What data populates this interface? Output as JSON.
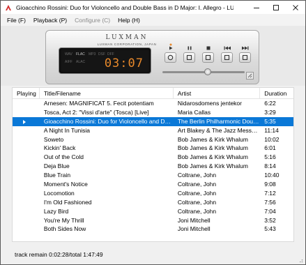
{
  "window": {
    "title": "Gioacchino Rossini: Duo for Violoncello and Double Bass in D Major: I. Allegro - LUXMAN..."
  },
  "menu": [
    {
      "label": "File (F)",
      "enabled": true
    },
    {
      "label": "Playback (P)",
      "enabled": true
    },
    {
      "label": "Configure (C)",
      "enabled": false
    },
    {
      "label": "Help (H)",
      "enabled": true
    }
  ],
  "player": {
    "brand": "LUXMAN",
    "brand_sub": "LUXMAN CORPORATION, JAPAN",
    "formats_top": [
      "WAV",
      "FLAC",
      "MP3",
      "DSF",
      "DFF"
    ],
    "formats_bottom": [
      "AIFF",
      "ALAC"
    ],
    "active_formats": [
      "FLAC"
    ],
    "time": "03:07",
    "accent_color": "#e8892b",
    "controls": [
      {
        "name": "play-button",
        "icon": "play-icon",
        "label_icon": "play-indicator-icon"
      },
      {
        "name": "pause-button",
        "icon": "pause-icon",
        "label_icon": "pause-indicator-icon"
      },
      {
        "name": "stop-button",
        "icon": "stop-icon",
        "label_icon": "stop-indicator-icon"
      },
      {
        "name": "previous-button",
        "icon": "previous-track-icon",
        "label_icon": "previous-indicator-icon"
      },
      {
        "name": "next-button",
        "icon": "next-track-icon",
        "label_icon": "next-indicator-icon"
      }
    ],
    "seek_fraction": 0.55
  },
  "playlist": {
    "columns": [
      "Playing",
      "Title/Filename",
      "Artist",
      "Duration"
    ],
    "selected_index": 2,
    "selection_color": "#0a78d7",
    "rows": [
      {
        "title": "Arnesen: MAGNIFICAT 5. Fecit potentiam",
        "artist": "Nidarosdomens jentekor",
        "duration": "6:22"
      },
      {
        "title": "Tosca, Act 2: \"Vissi d'arte\" (Tosca) [Live]",
        "artist": "Maria Callas",
        "duration": "3:29"
      },
      {
        "title": "Gioacchino Rossini: Duo for Violoncello and Double Bass in D Major: I. Allegro",
        "artist": "The Berlin Philharmonic Double Bass Quartet",
        "duration": "5:35"
      },
      {
        "title": "A Night In Tunisia",
        "artist": "Art Blakey & The Jazz Messengers",
        "duration": "11:14"
      },
      {
        "title": "Soweto",
        "artist": "Bob James & Kirk Whalum",
        "duration": "10:02"
      },
      {
        "title": "Kickin' Back",
        "artist": "Bob James & Kirk Whalum",
        "duration": "6:01"
      },
      {
        "title": "Out of the Cold",
        "artist": "Bob James & Kirk Whalum",
        "duration": "5:16"
      },
      {
        "title": "Deja Blue",
        "artist": "Bob James & Kirk Whalum",
        "duration": "8:14"
      },
      {
        "title": "Blue Train",
        "artist": "Coltrane, John",
        "duration": "10:40"
      },
      {
        "title": "Moment's Notice",
        "artist": "Coltrane, John",
        "duration": "9:08"
      },
      {
        "title": "Locomotion",
        "artist": "Coltrane, John",
        "duration": "7:12"
      },
      {
        "title": "I'm Old Fashioned",
        "artist": "Coltrane, John",
        "duration": "7:56"
      },
      {
        "title": "Lazy Bird",
        "artist": "Coltrane, John",
        "duration": "7:04"
      },
      {
        "title": "You're My Thrill",
        "artist": "Joni Mitchell",
        "duration": "3:52"
      },
      {
        "title": "Both Sides Now",
        "artist": "Joni Mitchell",
        "duration": "5:43"
      }
    ]
  },
  "status": {
    "text": "track remain 0:02:28/total 1:47:49"
  }
}
